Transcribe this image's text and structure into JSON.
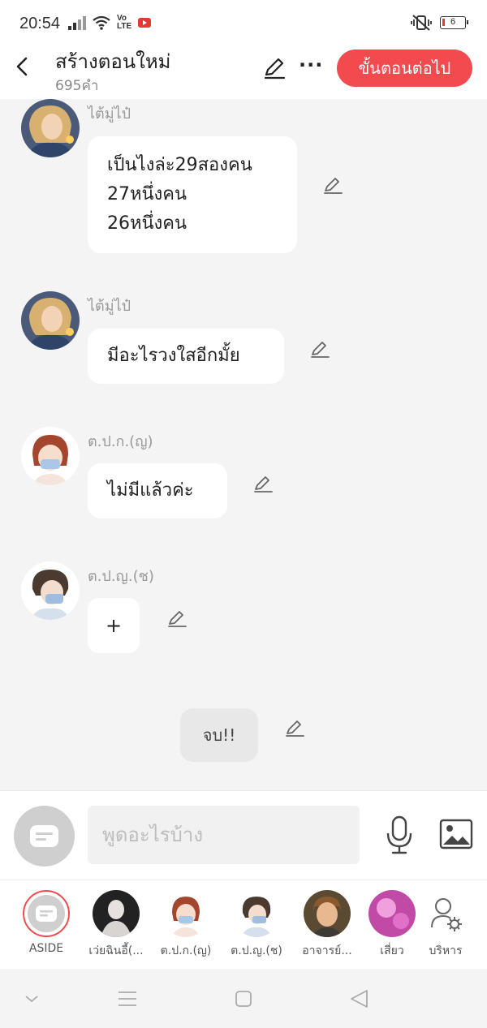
{
  "status_bar": {
    "time": "20:54",
    "volte": "Vo\nLTE",
    "battery": "6"
  },
  "header": {
    "title": "สร้างตอนใหม่",
    "word_count": "695คำ",
    "next_label": "ขั้นตอนต่อไป"
  },
  "messages": [
    {
      "sender": "ไต้มู่ไป๋",
      "lines": [
        "เป็นไงล่ะ29สองคน",
        "27หนึ่งคน",
        "26หนึ่งคน"
      ]
    },
    {
      "sender": "ไต้มู่ไป๋",
      "lines": [
        "มีอะไรวงใสอีกมั้ย"
      ]
    },
    {
      "sender": "ต.ป.ก.(ญ)",
      "lines": [
        "ไม่มีแล้วค่ะ"
      ]
    },
    {
      "sender": "ต.ป.ญ.(ช)",
      "plus": "+"
    }
  ],
  "end_label": "จบ!!",
  "input": {
    "placeholder": "พูดอะไรบ้าง"
  },
  "characters": [
    {
      "name": "ASIDE"
    },
    {
      "name": "เว่ยฉินอี้(..."
    },
    {
      "name": "ต.ป.ก.(ญ)"
    },
    {
      "name": "ต.ป.ญ.(ช)"
    },
    {
      "name": "อาจารย์..."
    },
    {
      "name": "เสี่ยว"
    },
    {
      "name": "บริหาร"
    }
  ],
  "colors": {
    "accent": "#f24a4f",
    "background": "#f4f4f4"
  }
}
